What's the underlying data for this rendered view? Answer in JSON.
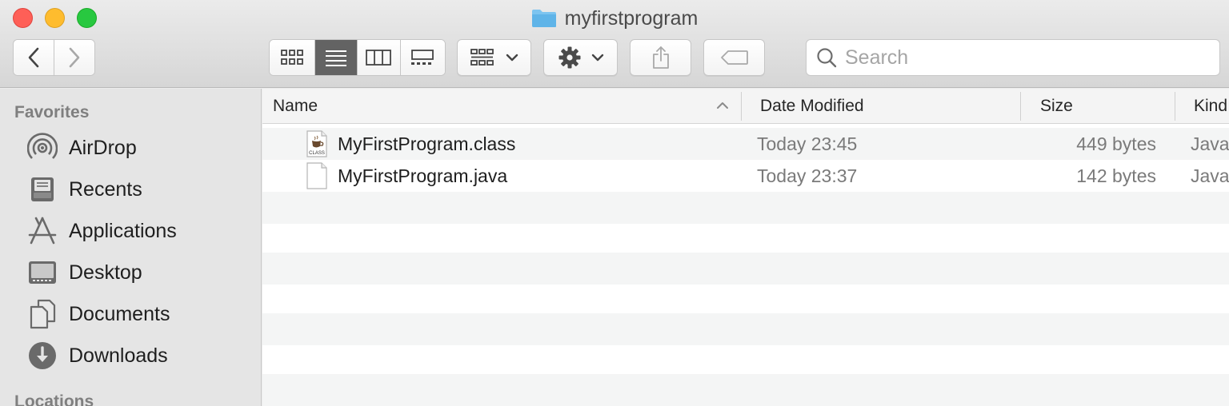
{
  "window": {
    "title": "myfirstprogram"
  },
  "toolbar": {
    "view_modes": [
      "icon",
      "list",
      "column",
      "gallery"
    ],
    "active_view": "list",
    "search": {
      "placeholder": "Search",
      "value": ""
    }
  },
  "sidebar": {
    "favorites_heading": "Favorites",
    "items": [
      {
        "label": "AirDrop",
        "icon": "airdrop-icon"
      },
      {
        "label": "Recents",
        "icon": "recents-icon"
      },
      {
        "label": "Applications",
        "icon": "applications-icon"
      },
      {
        "label": "Desktop",
        "icon": "desktop-icon"
      },
      {
        "label": "Documents",
        "icon": "documents-icon"
      },
      {
        "label": "Downloads",
        "icon": "downloads-icon"
      }
    ],
    "locations_heading": "Locations"
  },
  "columns": {
    "name": "Name",
    "date": "Date Modified",
    "size": "Size",
    "kind": "Kind"
  },
  "files": [
    {
      "name": "MyFirstProgram.class",
      "date": "Today 23:45",
      "size": "449 bytes",
      "kind": "Java",
      "icon_label": "CLASS"
    },
    {
      "name": "MyFirstProgram.java",
      "date": "Today 23:37",
      "size": "142 bytes",
      "kind": "Java"
    }
  ],
  "colors": {
    "accent_folder": "#5fb4e8",
    "active_segment": "#636363"
  }
}
